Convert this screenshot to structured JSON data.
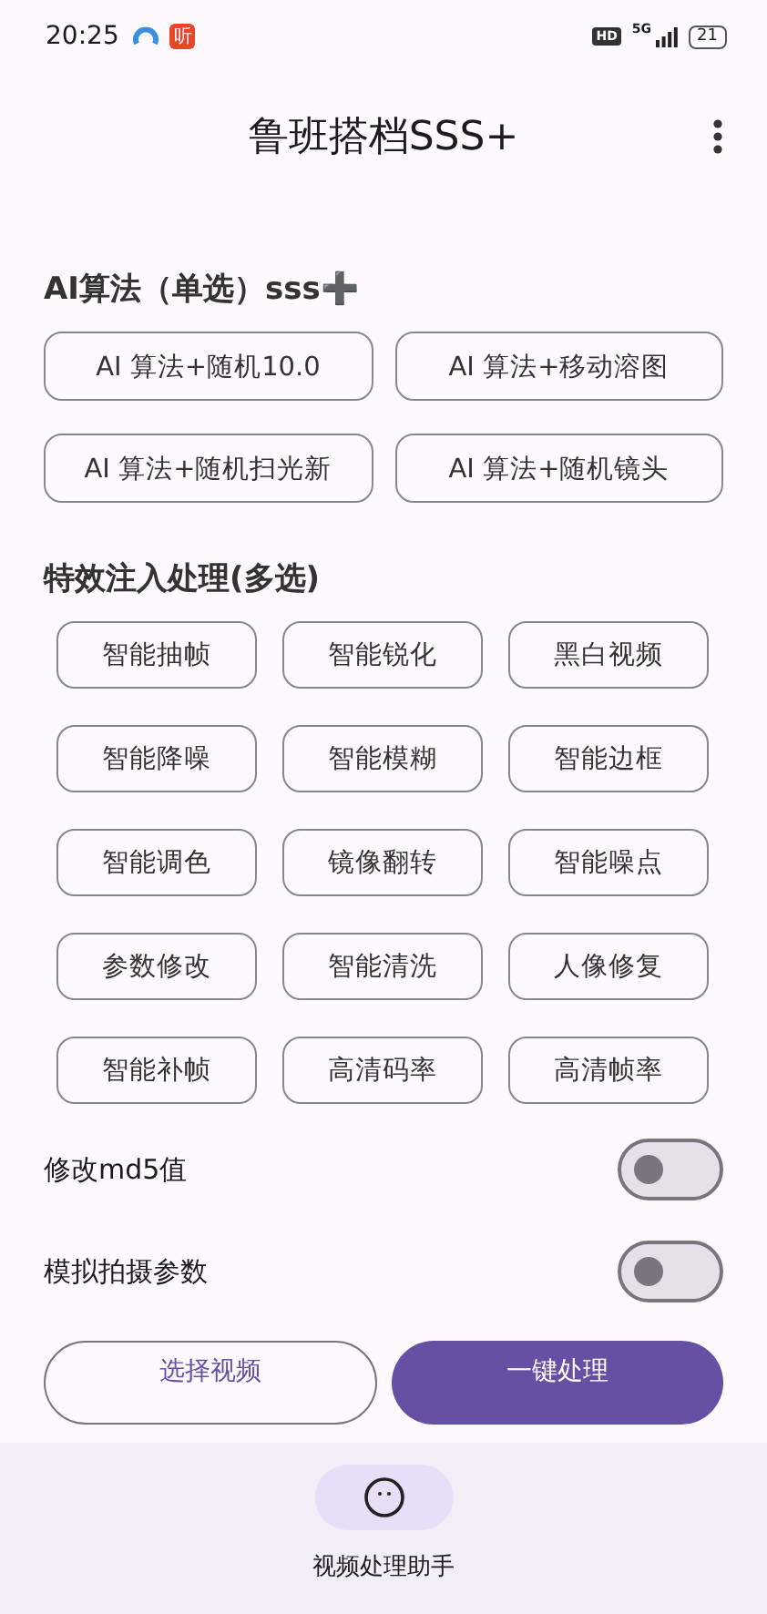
{
  "status_bar": {
    "time": "20:25",
    "app_badge": "听",
    "hd": "HD",
    "network": "5G",
    "battery": "21"
  },
  "app_bar": {
    "title": "鲁班搭档SSS+"
  },
  "algorithm_section": {
    "title": "AI算法（单选）sss➕",
    "options": [
      {
        "label": "AI 算法+随机10.0",
        "selected": false
      },
      {
        "label": "AI 算法+移动溶图",
        "selected": false
      },
      {
        "label": "AI 算法+随机扫光新",
        "selected": false
      },
      {
        "label": "AI 算法+随机镜头",
        "selected": false
      }
    ]
  },
  "effects_section": {
    "title": "特效注入处理(多选)",
    "options": [
      {
        "label": "智能抽帧",
        "selected": false
      },
      {
        "label": "智能锐化",
        "selected": false
      },
      {
        "label": "黑白视频",
        "selected": false
      },
      {
        "label": "智能降噪",
        "selected": false
      },
      {
        "label": "智能模糊",
        "selected": false
      },
      {
        "label": "智能边框",
        "selected": false
      },
      {
        "label": "智能调色",
        "selected": false
      },
      {
        "label": "镜像翻转",
        "selected": false
      },
      {
        "label": "智能噪点",
        "selected": false
      },
      {
        "label": "参数修改",
        "selected": false
      },
      {
        "label": "智能清洗",
        "selected": false
      },
      {
        "label": "人像修复",
        "selected": false
      },
      {
        "label": "智能补帧",
        "selected": false
      },
      {
        "label": "高清码率",
        "selected": false
      },
      {
        "label": "高清帧率",
        "selected": false
      }
    ]
  },
  "switches": [
    {
      "label": "修改md5值",
      "on": false
    },
    {
      "label": "模拟拍摄参数",
      "on": false
    }
  ],
  "actions": [
    {
      "label": "选择视频",
      "kind": "outlined"
    },
    {
      "label": "一键处理",
      "kind": "filled"
    }
  ],
  "bottom_nav": [
    {
      "label": "视频处理助手",
      "selected": true
    }
  ]
}
